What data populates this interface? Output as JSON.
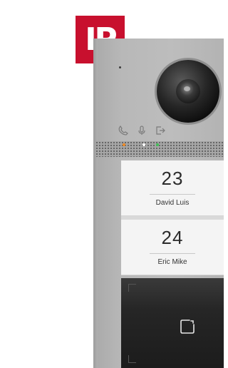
{
  "brand": {
    "badge_text": "IP",
    "badge_color": "#c8102e"
  },
  "status_icons": [
    "phone-icon",
    "microphone-icon",
    "door-open-icon"
  ],
  "indicator_colors": {
    "orange": "#f08a24",
    "white": "#ffffff",
    "green": "#43c159"
  },
  "name_cards": [
    {
      "number": "23",
      "name": "David Luis"
    },
    {
      "number": "24",
      "name": "Eric Mike"
    }
  ],
  "card_reader": {
    "icon": "door-square-icon"
  }
}
